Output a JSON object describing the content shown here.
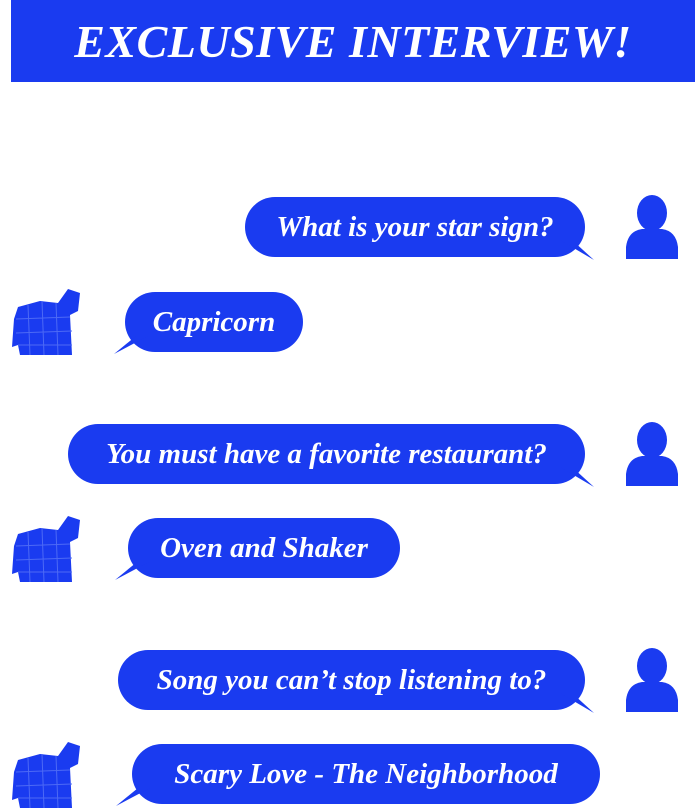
{
  "banner": {
    "title": "EXCLUSIVE INTERVIEW!"
  },
  "colors": {
    "accent": "#1a3bf0",
    "text": "#ffffff",
    "background": "#ffffff"
  },
  "icons": {
    "interviewer": "person-silhouette-icon",
    "interviewee": "jacket-icon"
  },
  "conversation": [
    {
      "question": "What is your star sign?",
      "answer": "Capricorn"
    },
    {
      "question": "You must have a favorite restaurant?",
      "answer": "Oven and Shaker"
    },
    {
      "question": "Song you can’t stop listening to?",
      "answer": "Scary Love - The Neighborhood"
    }
  ]
}
